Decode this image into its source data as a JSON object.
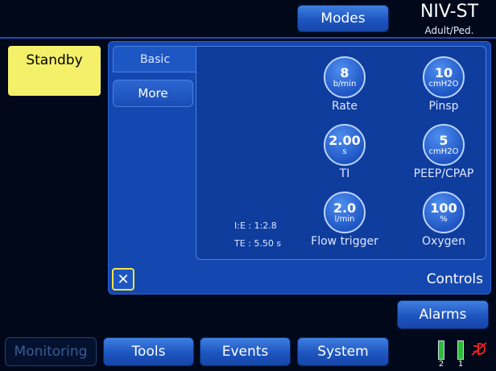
{
  "header": {
    "modes_label": "Modes",
    "mode_title": "NIV-ST",
    "patient_type": "Adult/Ped."
  },
  "status": {
    "standby_label": "Standby"
  },
  "panel": {
    "tabs": [
      {
        "label": "Basic"
      },
      {
        "label": "More"
      }
    ],
    "controls": [
      {
        "value": "8",
        "unit": "b/min",
        "label": "Rate"
      },
      {
        "value": "10",
        "unit": "cmH2O",
        "label": "Pinsp"
      },
      {
        "value": "2.00",
        "unit": "s",
        "label": "TI"
      },
      {
        "value": "5",
        "unit": "cmH2O",
        "label": "PEEP/CPAP"
      },
      {
        "value": "2.0",
        "unit": "l/min",
        "label": "Flow trigger"
      },
      {
        "value": "100",
        "unit": "%",
        "label": "Oxygen"
      }
    ],
    "ie_ratio": "I:E : 1:2.8",
    "te_value": "TE : 5.50 s",
    "close_symbol": "✕",
    "controls_title": "Controls"
  },
  "alarms_label": "Alarms",
  "bottom_nav": {
    "monitoring": "Monitoring",
    "tools": "Tools",
    "events": "Events",
    "system": "System"
  },
  "batteries": [
    {
      "label": "2"
    },
    {
      "label": "1"
    }
  ],
  "colors": {
    "background": "#00081a",
    "button_blue": "#1e55c0",
    "panel_blue": "#1547b0",
    "standby_yellow": "#f4f06a",
    "close_border": "#f2e34a",
    "battery_green": "#2dbb3a",
    "disconnected_red": "#e02020"
  }
}
